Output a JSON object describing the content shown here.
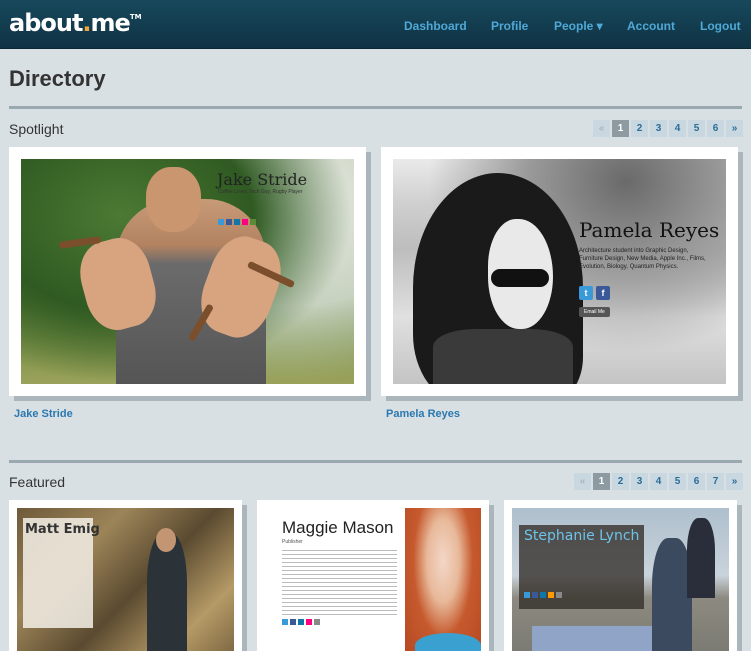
{
  "header": {
    "logo": {
      "text_main": "about",
      "text_dot": ".",
      "text_end": "me",
      "tm": "TM"
    },
    "nav": [
      {
        "label": "Dashboard"
      },
      {
        "label": "Profile"
      },
      {
        "label": "People ▾"
      },
      {
        "label": "Account"
      },
      {
        "label": "Logout"
      }
    ]
  },
  "page": {
    "title": "Directory"
  },
  "spotlight": {
    "title": "Spotlight",
    "pager": [
      "«",
      "1",
      "2",
      "3",
      "4",
      "5",
      "6",
      "»"
    ],
    "cards": [
      {
        "name": "Jake Stride",
        "photo_title": "Jake Stride",
        "photo_subtitle": "Coffee Lover, Tech Guy, Rugby Player"
      },
      {
        "name": "Pamela Reyes",
        "photo_title": "Pamela Reyes",
        "photo_subtitle": "Architecture student into Graphic Design, Furniture Design, New Media, Apple Inc., Films, Evolution, Biology, Quantum Physics.",
        "email_button": "Email Me"
      }
    ]
  },
  "featured": {
    "title": "Featured",
    "pager": [
      "«",
      "1",
      "2",
      "3",
      "4",
      "5",
      "6",
      "7",
      "»"
    ],
    "cards": [
      {
        "photo_title": "Matt Emig"
      },
      {
        "photo_title": "Maggie Mason",
        "photo_subtitle": "Publisher"
      },
      {
        "photo_title": "Stephanie Lynch"
      }
    ]
  },
  "colors": {
    "header_bg": "#12404f",
    "nav_link": "#4fa8d6",
    "accent_orange": "#f2a33a",
    "page_bg": "#d9e0e3",
    "card_name_link": "#2b78b0"
  }
}
